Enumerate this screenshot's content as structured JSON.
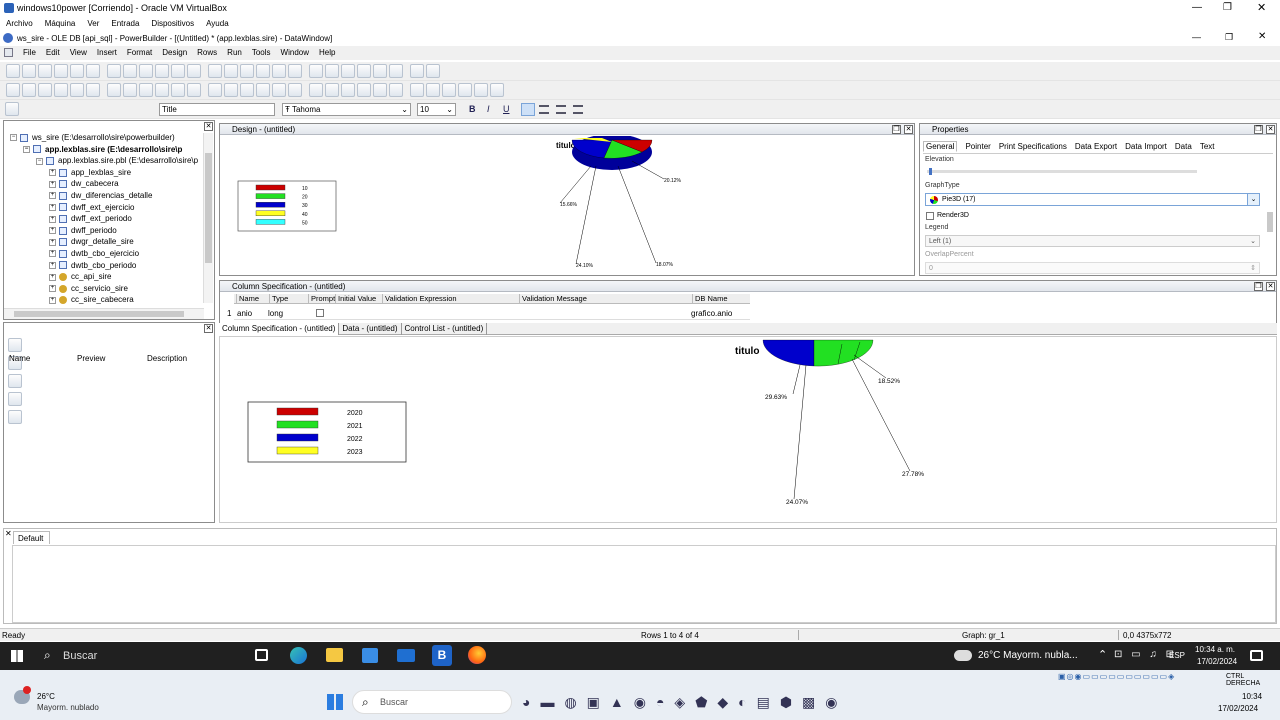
{
  "vbox": {
    "title": "windows10power [Corriendo] - Oracle VM VirtualBox",
    "menu": [
      "Archivo",
      "Máquina",
      "Ver",
      "Entrada",
      "Dispositivos",
      "Ayuda"
    ]
  },
  "pb": {
    "title": "ws_sire - OLE DB [api_sql] - PowerBuilder - [(Untitled) * (app.lexblas.sire) - DataWindow]",
    "menu": [
      "File",
      "Edit",
      "View",
      "Insert",
      "Format",
      "Design",
      "Rows",
      "Run",
      "Tools",
      "Window",
      "Help"
    ]
  },
  "format_bar": {
    "style_value": "Title",
    "font_value": "Tahoma",
    "size_value": "10",
    "bold": "B",
    "italic": "I",
    "underline": "U"
  },
  "tree": {
    "items": [
      {
        "label": "ws_sire (E:\\desarrollo\\sire\\powerbuilder)",
        "level": 0,
        "bold": false
      },
      {
        "label": "app.lexblas.sire (E:\\desarrollo\\sire\\p",
        "level": 1,
        "bold": true
      },
      {
        "label": "app.lexblas.sire.pbl (E:\\desarrollo\\sire\\p",
        "level": 2,
        "bold": false
      },
      {
        "label": "app_lexblas_sire",
        "level": 3,
        "bold": false
      },
      {
        "label": "dw_cabecera",
        "level": 3,
        "bold": false
      },
      {
        "label": "dw_diferencias_detalle",
        "level": 3,
        "bold": false
      },
      {
        "label": "dwff_ext_ejercicio",
        "level": 3,
        "bold": false
      },
      {
        "label": "dwff_ext_periodo",
        "level": 3,
        "bold": false
      },
      {
        "label": "dwff_periodo",
        "level": 3,
        "bold": false
      },
      {
        "label": "dwgr_detalle_sire",
        "level": 3,
        "bold": false
      },
      {
        "label": "dwtb_cbo_ejercicio",
        "level": 3,
        "bold": false
      },
      {
        "label": "dwtb_cbo_periodo",
        "level": 3,
        "bold": false
      },
      {
        "label": "cc_api_sire",
        "level": 3,
        "bold": false
      },
      {
        "label": "cc_servicio_sire",
        "level": 3,
        "bold": false
      },
      {
        "label": "cc_sire_cabecera",
        "level": 3,
        "bold": false
      }
    ]
  },
  "library_list": {
    "columns": [
      "Name",
      "Preview",
      "Description"
    ]
  },
  "design": {
    "title": "Design - (untitled)",
    "chart_title": "titulo",
    "legend": [
      "10",
      "20",
      "30",
      "40",
      "50"
    ],
    "labels": [
      "20.12%",
      "15.66%",
      "24.10%",
      "18.07%"
    ]
  },
  "properties": {
    "title": "Properties",
    "tabs": [
      "General",
      "Pointer",
      "Print Specifications",
      "Data Export",
      "Data Import",
      "Data",
      "Text"
    ],
    "elevation_label": "Elevation",
    "graphtype_label": "GraphType",
    "graphtype_value": "Pie3D (17)",
    "render3d_label": "Render3D",
    "legend_label": "Legend",
    "legend_value": "Left (1)",
    "overlap_label": "OverlapPercent",
    "overlap_value": "0"
  },
  "colspec": {
    "title": "Column Specification - (untitled)",
    "headers": [
      "Name",
      "Type",
      "Prompt",
      "Initial Value",
      "Validation Expression",
      "Validation Message",
      "DB Name"
    ],
    "row": {
      "num": "1",
      "name": "anio",
      "type": "long",
      "db": "grafico.anio"
    },
    "tabs": [
      "Column Specification - (untitled)",
      "Data - (untitled)",
      "Control List - (untitled)"
    ]
  },
  "preview": {
    "chart_title": "titulo",
    "legend": [
      "2020",
      "2021",
      "2022",
      "2023"
    ],
    "labels": [
      "18.52%",
      "29.63%",
      "27.78%",
      "24.07%"
    ]
  },
  "output": {
    "tab": "Default"
  },
  "status": {
    "ready": "Ready",
    "rows": "Rows 1 to 4 of 4",
    "graph": "Graph: gr_1",
    "coords": "0,0 4375x772"
  },
  "taskbar": {
    "search": "Buscar",
    "weather": "26°C  Mayorm. nubla...",
    "lang": "ESP",
    "time": "10:34 a. m.",
    "date": "17/02/2024"
  },
  "taskbar2": {
    "temp": "26°C",
    "weather": "Mayorm. nublado",
    "search": "Buscar",
    "ctrl": "CTRL DERECHA",
    "time": "10:34",
    "date": "17/02/2024"
  },
  "colors": {
    "red": "#cc0000",
    "green": "#22e022",
    "blue": "#0000cc",
    "yellow": "#ffff22",
    "cyan": "#33ffff"
  },
  "chart_data": [
    {
      "type": "pie",
      "title": "titulo",
      "categories": [
        "2020",
        "2021",
        "2022",
        "2023"
      ],
      "values": [
        18.52,
        29.63,
        27.78,
        24.07
      ],
      "legend_position": "left"
    }
  ]
}
